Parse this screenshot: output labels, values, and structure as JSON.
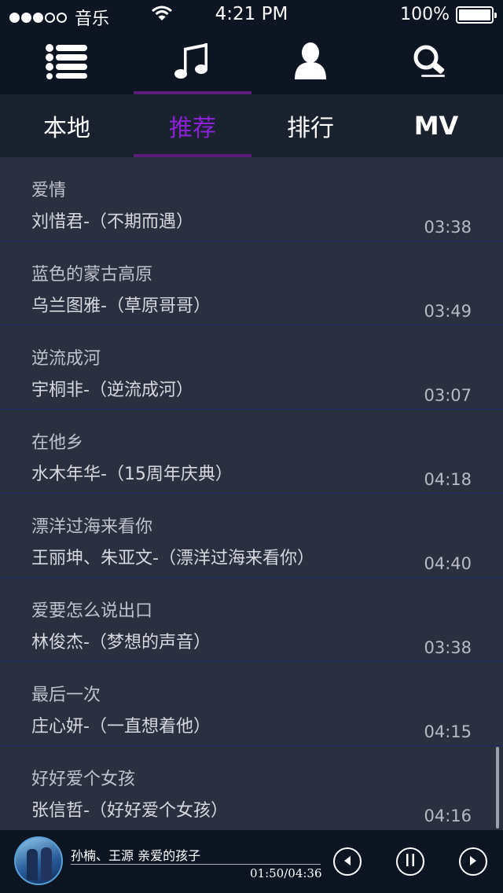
{
  "status_bar": {
    "carrier": "音乐",
    "time": "4:21 PM",
    "battery": "100%",
    "signal_dots_filled": 3,
    "signal_dots_total": 5
  },
  "icon_nav": {
    "items": [
      {
        "name": "list-icon",
        "active": false
      },
      {
        "name": "music-note-icon",
        "active": true
      },
      {
        "name": "user-icon",
        "active": false
      },
      {
        "name": "search-icon",
        "active": false
      }
    ]
  },
  "tabs": [
    {
      "label": "本地",
      "active": false
    },
    {
      "label": "推荐",
      "active": true
    },
    {
      "label": "排行",
      "active": false
    },
    {
      "label": "MV",
      "active": false
    }
  ],
  "songs": [
    {
      "title": "爱情",
      "artist": "刘惜君-（不期而遇）",
      "duration": "03:38"
    },
    {
      "title": "蓝色的蒙古高原",
      "artist": "乌兰图雅-（草原哥哥）",
      "duration": "03:49"
    },
    {
      "title": "逆流成河",
      "artist": "宇桐非-（逆流成河）",
      "duration": "03:07"
    },
    {
      "title": "在他乡",
      "artist": "水木年华-（15周年庆典）",
      "duration": "04:18"
    },
    {
      "title": "漂洋过海来看你",
      "artist": "王丽坤、朱亚文-（漂洋过海来看你）",
      "duration": "04:40"
    },
    {
      "title": "爱要怎么说出口",
      "artist": "林俊杰-（梦想的声音）",
      "duration": "03:38"
    },
    {
      "title": "最后一次",
      "artist": "庄心妍-（一直想着他）",
      "duration": "04:15"
    },
    {
      "title": "好好爱个女孩",
      "artist": "张信哲-（好好爱个女孩）",
      "duration": "04:16"
    }
  ],
  "player": {
    "now_playing": "孙楠、王源 亲爱的孩子",
    "time": "01:50/04:36"
  },
  "colors": {
    "accent": "#8a22d4",
    "underline": "#5b1e78",
    "divider": "#1d2a73",
    "bar_bg": "#0e1522",
    "list_bg": "#2a3040"
  }
}
